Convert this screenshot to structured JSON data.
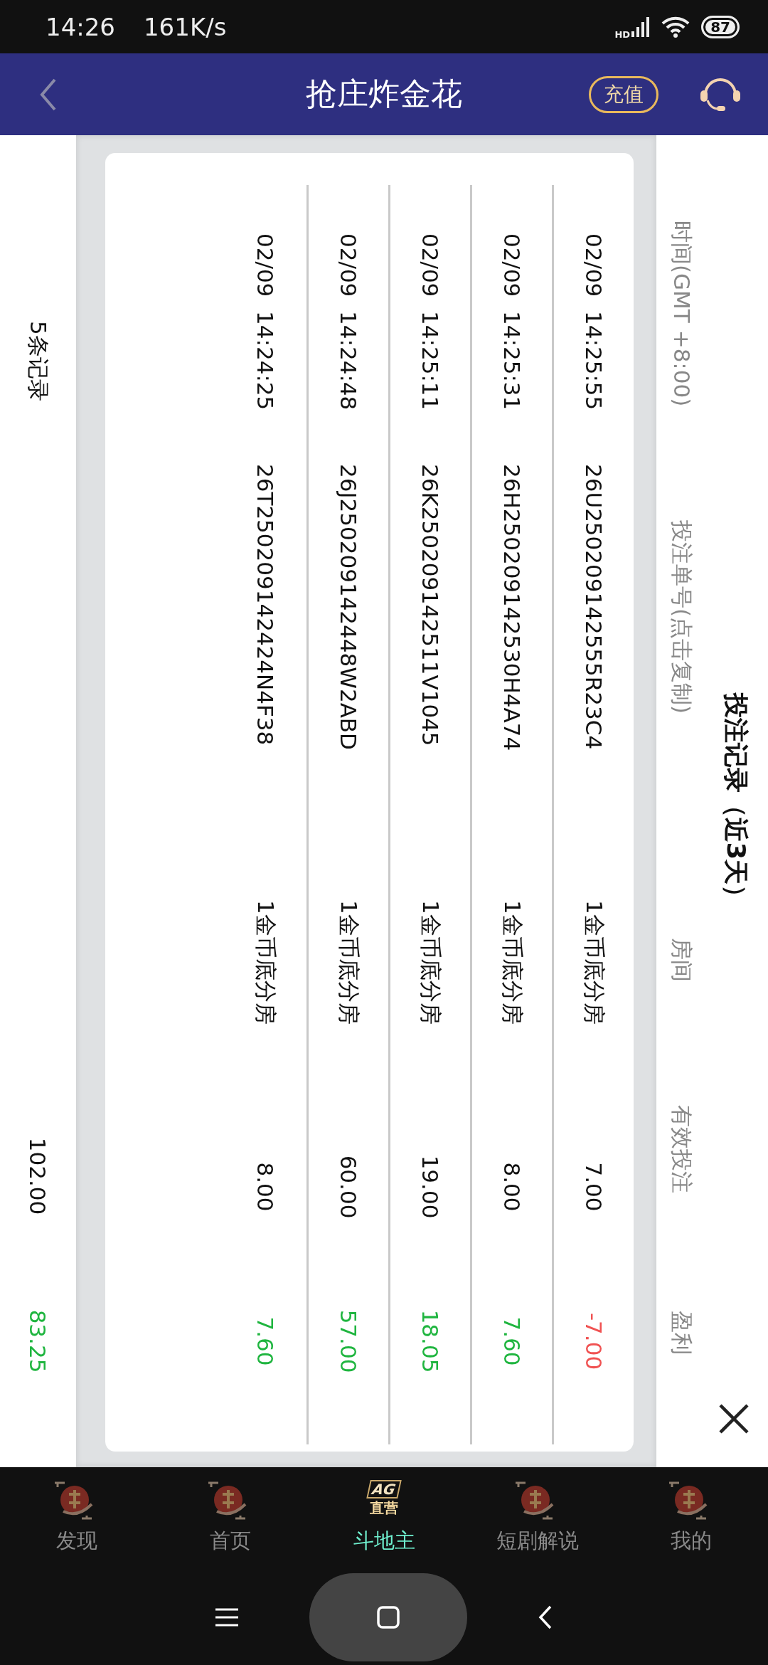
{
  "status_bar": {
    "time": "14:26",
    "speed": "161K/s",
    "network": "HD",
    "battery": "87"
  },
  "header": {
    "title": "抢庄炸金花",
    "recharge": "充值"
  },
  "panel": {
    "title": "投注记录（近3天）",
    "columns": [
      "时间(GMT +8:00)",
      "投注单号(点击复制)",
      "房间",
      "有效投注",
      "盈利"
    ],
    "rows": [
      {
        "time": "02/09  14:25:55",
        "order": "26U250209142555R23C4",
        "room": "1金币底分房",
        "bet": "7.00",
        "profit": "-7.00",
        "color": "#f05252"
      },
      {
        "time": "02/09  14:25:31",
        "order": "26H250209142530H4A74",
        "room": "1金币底分房",
        "bet": "8.00",
        "profit": "7.60",
        "color": "#1fb53f"
      },
      {
        "time": "02/09  14:25:11",
        "order": "26K250209142511V1045",
        "room": "1金币底分房",
        "bet": "19.00",
        "profit": "18.05",
        "color": "#1fb53f"
      },
      {
        "time": "02/09  14:24:48",
        "order": "26J250209142448W2ABD",
        "room": "1金币底分房",
        "bet": "60.00",
        "profit": "57.00",
        "color": "#1fb53f"
      },
      {
        "time": "02/09  14:24:25",
        "order": "26T250209142424N4F38",
        "room": "1金币底分房",
        "bet": "8.00",
        "profit": "7.60",
        "color": "#1fb53f"
      }
    ],
    "totals": {
      "count": "5条记录",
      "bet": "102.00",
      "profit": "83.25",
      "color": "#1fb53f"
    }
  },
  "nav": [
    {
      "label": "发现",
      "kind": "lantern",
      "selected": false
    },
    {
      "label": "首页",
      "kind": "lantern",
      "selected": false
    },
    {
      "label": "斗地主",
      "kind": "ag",
      "selected": true,
      "logo": "AG",
      "badge": "直营"
    },
    {
      "label": "短剧解说",
      "kind": "lantern",
      "selected": false
    },
    {
      "label": "我的",
      "kind": "lantern",
      "selected": false
    }
  ]
}
